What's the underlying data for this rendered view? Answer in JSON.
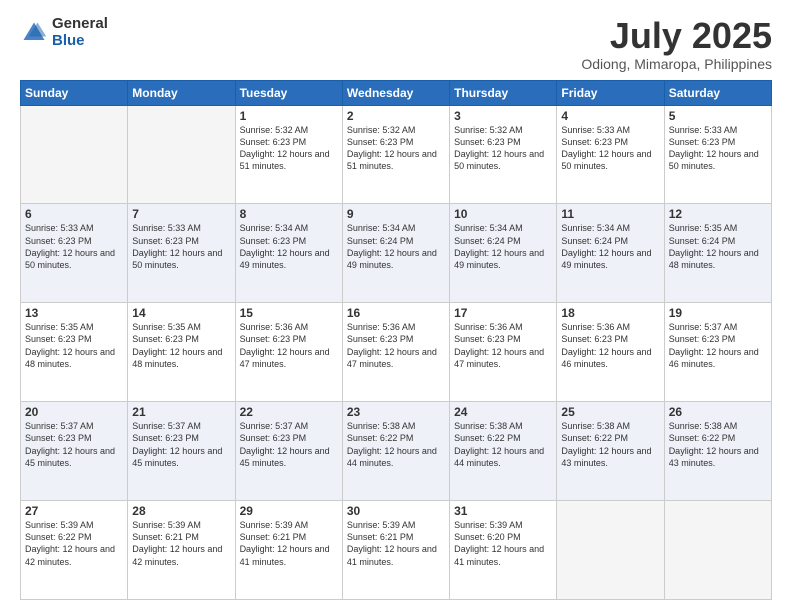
{
  "logo": {
    "general": "General",
    "blue": "Blue"
  },
  "header": {
    "title": "July 2025",
    "subtitle": "Odiong, Mimaropa, Philippines"
  },
  "weekdays": [
    "Sunday",
    "Monday",
    "Tuesday",
    "Wednesday",
    "Thursday",
    "Friday",
    "Saturday"
  ],
  "weeks": [
    [
      {
        "day": "",
        "sunrise": "",
        "sunset": "",
        "daylight": "",
        "empty": true
      },
      {
        "day": "",
        "sunrise": "",
        "sunset": "",
        "daylight": "",
        "empty": true
      },
      {
        "day": "1",
        "sunrise": "Sunrise: 5:32 AM",
        "sunset": "Sunset: 6:23 PM",
        "daylight": "Daylight: 12 hours and 51 minutes.",
        "empty": false
      },
      {
        "day": "2",
        "sunrise": "Sunrise: 5:32 AM",
        "sunset": "Sunset: 6:23 PM",
        "daylight": "Daylight: 12 hours and 51 minutes.",
        "empty": false
      },
      {
        "day": "3",
        "sunrise": "Sunrise: 5:32 AM",
        "sunset": "Sunset: 6:23 PM",
        "daylight": "Daylight: 12 hours and 50 minutes.",
        "empty": false
      },
      {
        "day": "4",
        "sunrise": "Sunrise: 5:33 AM",
        "sunset": "Sunset: 6:23 PM",
        "daylight": "Daylight: 12 hours and 50 minutes.",
        "empty": false
      },
      {
        "day": "5",
        "sunrise": "Sunrise: 5:33 AM",
        "sunset": "Sunset: 6:23 PM",
        "daylight": "Daylight: 12 hours and 50 minutes.",
        "empty": false
      }
    ],
    [
      {
        "day": "6",
        "sunrise": "Sunrise: 5:33 AM",
        "sunset": "Sunset: 6:23 PM",
        "daylight": "Daylight: 12 hours and 50 minutes.",
        "empty": false
      },
      {
        "day": "7",
        "sunrise": "Sunrise: 5:33 AM",
        "sunset": "Sunset: 6:23 PM",
        "daylight": "Daylight: 12 hours and 50 minutes.",
        "empty": false
      },
      {
        "day": "8",
        "sunrise": "Sunrise: 5:34 AM",
        "sunset": "Sunset: 6:23 PM",
        "daylight": "Daylight: 12 hours and 49 minutes.",
        "empty": false
      },
      {
        "day": "9",
        "sunrise": "Sunrise: 5:34 AM",
        "sunset": "Sunset: 6:24 PM",
        "daylight": "Daylight: 12 hours and 49 minutes.",
        "empty": false
      },
      {
        "day": "10",
        "sunrise": "Sunrise: 5:34 AM",
        "sunset": "Sunset: 6:24 PM",
        "daylight": "Daylight: 12 hours and 49 minutes.",
        "empty": false
      },
      {
        "day": "11",
        "sunrise": "Sunrise: 5:34 AM",
        "sunset": "Sunset: 6:24 PM",
        "daylight": "Daylight: 12 hours and 49 minutes.",
        "empty": false
      },
      {
        "day": "12",
        "sunrise": "Sunrise: 5:35 AM",
        "sunset": "Sunset: 6:24 PM",
        "daylight": "Daylight: 12 hours and 48 minutes.",
        "empty": false
      }
    ],
    [
      {
        "day": "13",
        "sunrise": "Sunrise: 5:35 AM",
        "sunset": "Sunset: 6:23 PM",
        "daylight": "Daylight: 12 hours and 48 minutes.",
        "empty": false
      },
      {
        "day": "14",
        "sunrise": "Sunrise: 5:35 AM",
        "sunset": "Sunset: 6:23 PM",
        "daylight": "Daylight: 12 hours and 48 minutes.",
        "empty": false
      },
      {
        "day": "15",
        "sunrise": "Sunrise: 5:36 AM",
        "sunset": "Sunset: 6:23 PM",
        "daylight": "Daylight: 12 hours and 47 minutes.",
        "empty": false
      },
      {
        "day": "16",
        "sunrise": "Sunrise: 5:36 AM",
        "sunset": "Sunset: 6:23 PM",
        "daylight": "Daylight: 12 hours and 47 minutes.",
        "empty": false
      },
      {
        "day": "17",
        "sunrise": "Sunrise: 5:36 AM",
        "sunset": "Sunset: 6:23 PM",
        "daylight": "Daylight: 12 hours and 47 minutes.",
        "empty": false
      },
      {
        "day": "18",
        "sunrise": "Sunrise: 5:36 AM",
        "sunset": "Sunset: 6:23 PM",
        "daylight": "Daylight: 12 hours and 46 minutes.",
        "empty": false
      },
      {
        "day": "19",
        "sunrise": "Sunrise: 5:37 AM",
        "sunset": "Sunset: 6:23 PM",
        "daylight": "Daylight: 12 hours and 46 minutes.",
        "empty": false
      }
    ],
    [
      {
        "day": "20",
        "sunrise": "Sunrise: 5:37 AM",
        "sunset": "Sunset: 6:23 PM",
        "daylight": "Daylight: 12 hours and 45 minutes.",
        "empty": false
      },
      {
        "day": "21",
        "sunrise": "Sunrise: 5:37 AM",
        "sunset": "Sunset: 6:23 PM",
        "daylight": "Daylight: 12 hours and 45 minutes.",
        "empty": false
      },
      {
        "day": "22",
        "sunrise": "Sunrise: 5:37 AM",
        "sunset": "Sunset: 6:23 PM",
        "daylight": "Daylight: 12 hours and 45 minutes.",
        "empty": false
      },
      {
        "day": "23",
        "sunrise": "Sunrise: 5:38 AM",
        "sunset": "Sunset: 6:22 PM",
        "daylight": "Daylight: 12 hours and 44 minutes.",
        "empty": false
      },
      {
        "day": "24",
        "sunrise": "Sunrise: 5:38 AM",
        "sunset": "Sunset: 6:22 PM",
        "daylight": "Daylight: 12 hours and 44 minutes.",
        "empty": false
      },
      {
        "day": "25",
        "sunrise": "Sunrise: 5:38 AM",
        "sunset": "Sunset: 6:22 PM",
        "daylight": "Daylight: 12 hours and 43 minutes.",
        "empty": false
      },
      {
        "day": "26",
        "sunrise": "Sunrise: 5:38 AM",
        "sunset": "Sunset: 6:22 PM",
        "daylight": "Daylight: 12 hours and 43 minutes.",
        "empty": false
      }
    ],
    [
      {
        "day": "27",
        "sunrise": "Sunrise: 5:39 AM",
        "sunset": "Sunset: 6:22 PM",
        "daylight": "Daylight: 12 hours and 42 minutes.",
        "empty": false
      },
      {
        "day": "28",
        "sunrise": "Sunrise: 5:39 AM",
        "sunset": "Sunset: 6:21 PM",
        "daylight": "Daylight: 12 hours and 42 minutes.",
        "empty": false
      },
      {
        "day": "29",
        "sunrise": "Sunrise: 5:39 AM",
        "sunset": "Sunset: 6:21 PM",
        "daylight": "Daylight: 12 hours and 41 minutes.",
        "empty": false
      },
      {
        "day": "30",
        "sunrise": "Sunrise: 5:39 AM",
        "sunset": "Sunset: 6:21 PM",
        "daylight": "Daylight: 12 hours and 41 minutes.",
        "empty": false
      },
      {
        "day": "31",
        "sunrise": "Sunrise: 5:39 AM",
        "sunset": "Sunset: 6:20 PM",
        "daylight": "Daylight: 12 hours and 41 minutes.",
        "empty": false
      },
      {
        "day": "",
        "sunrise": "",
        "sunset": "",
        "daylight": "",
        "empty": true
      },
      {
        "day": "",
        "sunrise": "",
        "sunset": "",
        "daylight": "",
        "empty": true
      }
    ]
  ]
}
